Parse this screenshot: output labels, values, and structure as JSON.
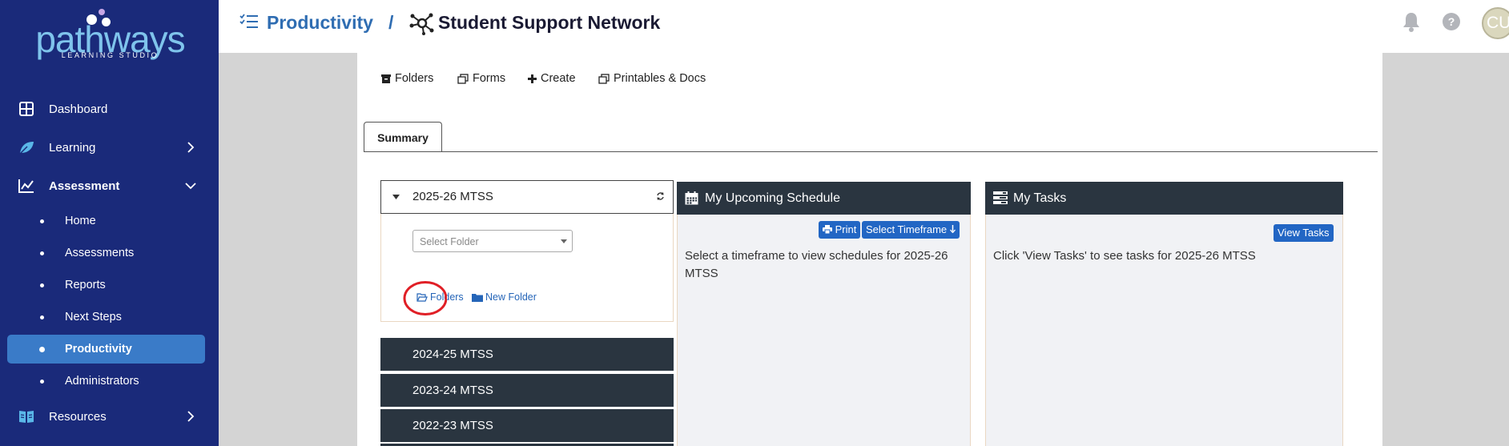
{
  "brand": {
    "name": "pathways",
    "tagline": "LEARNING STUDIO"
  },
  "nav": {
    "dashboard": "Dashboard",
    "learning": "Learning",
    "assessment": "Assessment",
    "resources": "Resources",
    "assessment_sub": [
      "Home",
      "Assessments",
      "Reports",
      "Next Steps",
      "Productivity",
      "Administrators"
    ],
    "active_sub": "Productivity"
  },
  "header": {
    "section": "Productivity",
    "separator": "/",
    "page": "Student Support Network",
    "avatar": "CU"
  },
  "toolbar": {
    "folders": "Folders",
    "forms": "Forms",
    "create": "Create",
    "printables": "Printables & Docs"
  },
  "tabs": {
    "summary": "Summary"
  },
  "years": {
    "open": "2025-26 MTSS",
    "closed": [
      "2024-25 MTSS",
      "2023-24 MTSS",
      "2022-23 MTSS"
    ]
  },
  "folder_panel": {
    "select_placeholder": "Select Folder",
    "folders_link": "Folders",
    "new_folder_link": "New Folder"
  },
  "schedule": {
    "title": "My Upcoming Schedule",
    "print": "Print",
    "select_timeframe": "Select Timeframe",
    "message": "Select a timeframe to view schedules for 2025-26 MTSS"
  },
  "tasks": {
    "title": "My Tasks",
    "view_tasks": "View Tasks",
    "message": "Click 'View Tasks' to see tasks for 2025-26 MTSS"
  },
  "colors": {
    "sidebar": "#1a2a7a",
    "active": "#3a7bc8",
    "brand_blue": "#2f6db2",
    "panel_dark": "#2a3540",
    "button_blue": "#2266c4",
    "annotation_red": "#e01f26"
  }
}
